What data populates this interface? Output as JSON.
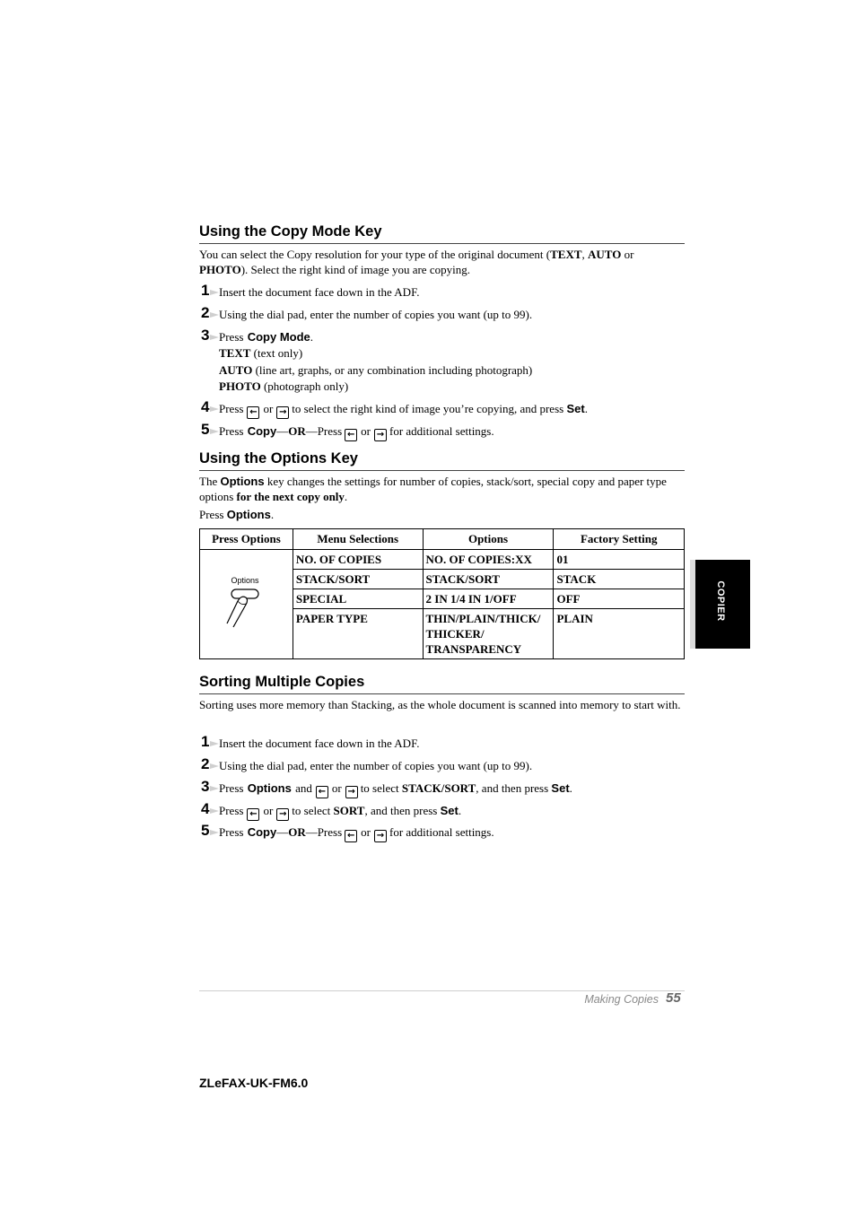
{
  "sections": {
    "copy_mode": {
      "title": "Using the Copy Mode Key",
      "intro": {
        "a": "You can select the Copy resolution for your type of the original document (",
        "text": "TEXT",
        "comma": ", ",
        "auto": "AUTO",
        "or": " or",
        "photo": "PHOTO",
        "b": "). Select the right kind of image you are copying."
      },
      "steps": [
        {
          "num": "1",
          "text": "Insert the document face down in the ADF."
        },
        {
          "num": "2",
          "text": "Using the dial pad, enter the number of copies you want (up to 99)."
        },
        {
          "num": "3",
          "pre": "Press ",
          "key": "Copy Mode",
          "post": ".",
          "modes": [
            {
              "name": "TEXT",
              "desc": " (text only)"
            },
            {
              "name": "AUTO",
              "desc": " (line art, graphs, or any combination including photograph)"
            },
            {
              "name": "PHOTO",
              "desc": " (photograph only)"
            }
          ]
        },
        {
          "num": "4",
          "pre": "Press",
          "or": "or",
          "mid": "to select the right kind of image you’re copying, and press ",
          "key": "Set",
          "post": "."
        },
        {
          "num": "5",
          "pre": "Press ",
          "key": "Copy",
          "dash1": "—",
          "or_bold": "OR",
          "dash2": "—Press",
          "or": "or",
          "post": "for additional settings."
        }
      ]
    },
    "options": {
      "title": "Using the Options Key",
      "intro": {
        "a": "The ",
        "key": "Options",
        "b": " key changes the settings for number of copies, stack/sort, special copy and paper type",
        "c": "options ",
        "bold": "for the next copy only",
        "d": "."
      },
      "press": {
        "pre": "Press ",
        "key": "Options",
        "post": "."
      },
      "table": {
        "headers": [
          "Press Options",
          "Menu Selections",
          "Options",
          "Factory Setting"
        ],
        "button_caption": "Options",
        "rows": [
          {
            "menu": "NO. OF COPIES",
            "options": "NO. OF COPIES:XX",
            "factory": "01"
          },
          {
            "menu": "STACK/SORT",
            "options": "STACK/SORT",
            "factory": "STACK"
          },
          {
            "menu": "SPECIAL",
            "options": "2 IN 1/4 IN 1/OFF",
            "factory": "OFF"
          },
          {
            "menu": "PAPER TYPE",
            "options": "THIN/PLAIN/THICK/ THICKER/ TRANSPARENCY",
            "factory": "PLAIN"
          }
        ]
      }
    },
    "sorting": {
      "title": "Sorting Multiple Copies",
      "intro": "Sorting uses more memory than Stacking, as the whole document is scanned into memory to start with.",
      "steps": [
        {
          "num": "1",
          "text": "Insert the document face down in the ADF."
        },
        {
          "num": "2",
          "text": "Using the dial pad, enter the number of copies you want (up to 99)."
        },
        {
          "num": "3",
          "pre": "Press ",
          "key": "Options",
          "and": " and",
          "or": "or",
          "mid": "to select ",
          "bold": "STACK/SORT",
          "mid2": ", and then press ",
          "key2": "Set",
          "post": "."
        },
        {
          "num": "4",
          "pre": "Press",
          "or": "or",
          "mid": "to select ",
          "bold": "SORT",
          "mid2": ", and then press ",
          "key2": "Set",
          "post": "."
        },
        {
          "num": "5",
          "pre": "Press ",
          "key": "Copy",
          "dash1": "—",
          "or_bold": "OR",
          "dash2": "—Press",
          "or": "or",
          "post": "for additional settings."
        }
      ]
    }
  },
  "icons": {
    "left_arrow": "←",
    "right_arrow": "→"
  },
  "side_tab": {
    "label": "COPIER",
    "color": "#000000"
  },
  "footer": {
    "chapter": "Making Copies",
    "page": "55"
  },
  "doc_id": "ZLeFAX-UK-FM6.0"
}
